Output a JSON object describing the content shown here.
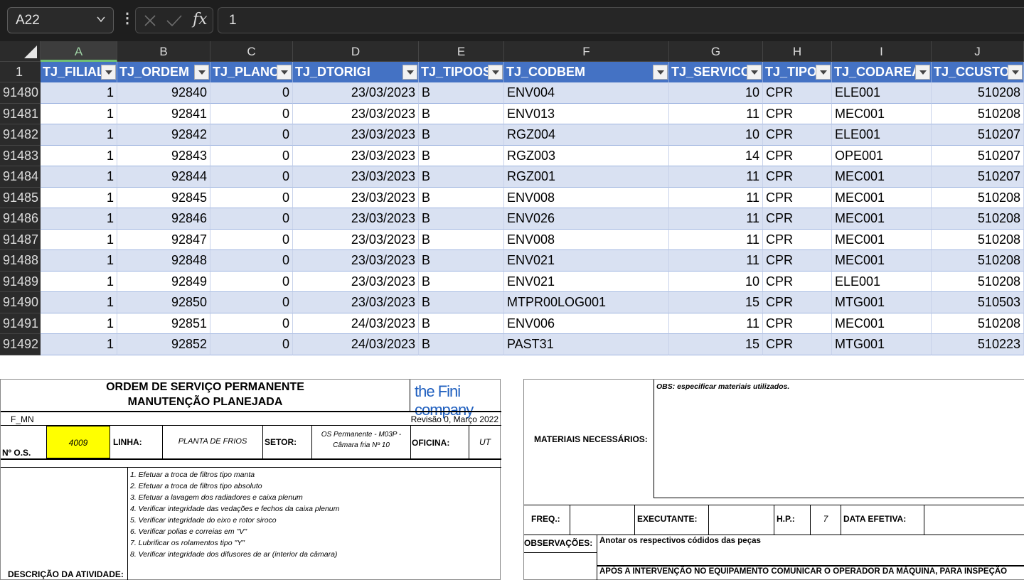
{
  "formula_bar": {
    "name_box": "A22",
    "fx_label": "fx",
    "content": "1"
  },
  "grid": {
    "columns": [
      "A",
      "B",
      "C",
      "D",
      "E",
      "F",
      "G",
      "H",
      "I",
      "J"
    ],
    "header_row_number": "1",
    "headers": [
      "TJ_FILIAL",
      "TJ_ORDEM",
      "TJ_PLANO",
      "TJ_DTORIGI",
      "TJ_TIPOOS",
      "TJ_CODBEM",
      "TJ_SERVICO",
      "TJ_TIPO",
      "TJ_CODAREA",
      "TJ_CCUSTO"
    ],
    "rows": [
      {
        "n": "91480",
        "c": [
          "1",
          "92840",
          "0",
          "23/03/2023",
          "B",
          "ENV004",
          "10",
          "CPR",
          "ELE001",
          "510208"
        ]
      },
      {
        "n": "91481",
        "c": [
          "1",
          "92841",
          "0",
          "23/03/2023",
          "B",
          "ENV013",
          "11",
          "CPR",
          "MEC001",
          "510208"
        ]
      },
      {
        "n": "91482",
        "c": [
          "1",
          "92842",
          "0",
          "23/03/2023",
          "B",
          "RGZ004",
          "10",
          "CPR",
          "ELE001",
          "510207"
        ]
      },
      {
        "n": "91483",
        "c": [
          "1",
          "92843",
          "0",
          "23/03/2023",
          "B",
          "RGZ003",
          "14",
          "CPR",
          "OPE001",
          "510207"
        ]
      },
      {
        "n": "91484",
        "c": [
          "1",
          "92844",
          "0",
          "23/03/2023",
          "B",
          "RGZ001",
          "11",
          "CPR",
          "MEC001",
          "510207"
        ]
      },
      {
        "n": "91485",
        "c": [
          "1",
          "92845",
          "0",
          "23/03/2023",
          "B",
          "ENV008",
          "11",
          "CPR",
          "MEC001",
          "510208"
        ]
      },
      {
        "n": "91486",
        "c": [
          "1",
          "92846",
          "0",
          "23/03/2023",
          "B",
          "ENV026",
          "11",
          "CPR",
          "MEC001",
          "510208"
        ]
      },
      {
        "n": "91487",
        "c": [
          "1",
          "92847",
          "0",
          "23/03/2023",
          "B",
          "ENV008",
          "11",
          "CPR",
          "MEC001",
          "510208"
        ]
      },
      {
        "n": "91488",
        "c": [
          "1",
          "92848",
          "0",
          "23/03/2023",
          "B",
          "ENV021",
          "11",
          "CPR",
          "MEC001",
          "510208"
        ]
      },
      {
        "n": "91489",
        "c": [
          "1",
          "92849",
          "0",
          "23/03/2023",
          "B",
          "ENV021",
          "10",
          "CPR",
          "ELE001",
          "510208"
        ]
      },
      {
        "n": "91490",
        "c": [
          "1",
          "92850",
          "0",
          "23/03/2023",
          "B",
          "MTPR00LOG001",
          "15",
          "CPR",
          "MTG001",
          "510503"
        ]
      },
      {
        "n": "91491",
        "c": [
          "1",
          "92851",
          "0",
          "24/03/2023",
          "B",
          "ENV006",
          "11",
          "CPR",
          "MEC001",
          "510208"
        ]
      },
      {
        "n": "91492",
        "c": [
          "1",
          "92852",
          "0",
          "24/03/2023",
          "B",
          "PAST31",
          "15",
          "CPR",
          "MTG001",
          "510223"
        ]
      }
    ]
  },
  "form_left": {
    "title_line1": "ORDEM DE SERVIÇO PERMANENTE",
    "title_line2": "MANUTENÇÃO PLANEJADA",
    "logo": "the Fini company",
    "form_code": "F_MN",
    "revision": "Revisão 0, Março 2022",
    "os_label": "Nº O.S.",
    "os_value": "4009",
    "linha_label": "LINHA:",
    "linha_value": "PLANTA DE FRIOS",
    "setor_label": "SETOR:",
    "setor_value_line1": "OS Permanente - M03P -",
    "setor_value_line2": "Câmara fria Nº 10",
    "oficina_label": "OFICINA:",
    "oficina_value": "UT",
    "descricao_label": "DESCRIÇÃO DA ATIVIDADE:",
    "activities": [
      "1. Efetuar a troca de filtros tipo manta",
      "2. Efetuar a troca de filtros tipo absoluto",
      "3. Efetuar a lavagem dos radiadores e caixa plenum",
      "4. Verificar integridade das vedações e fechos da caixa plenum",
      "5. Verificar integridade do eixo e rotor siroco",
      "6. Verificar polias e correias em \"V\"",
      "7. Lubrificar os rolamentos tipo \"Y\"",
      "8. Verificar integridade dos difusores de ar (interior da câmara)"
    ]
  },
  "form_right": {
    "obs_note": "OBS: especificar materiais utilizados.",
    "materiais_label": "MATERIAIS NECESSÁRIOS:",
    "freq_label": "FREQ.:",
    "executante_label": "EXECUTANTE:",
    "hp_label": "H.P.:",
    "hp_value": "7",
    "data_label": "DATA EFETIVA:",
    "observacoes_label": "OBSERVAÇÕES:",
    "observacoes_value": "Anotar os respectivos códidos das peças",
    "footer_note": "APÓS A INTERVENÇÃO NO EQUIPAMENTO COMUNICAR O OPERADOR DA MÁQUINA, PARA INSPEÇÃO"
  }
}
